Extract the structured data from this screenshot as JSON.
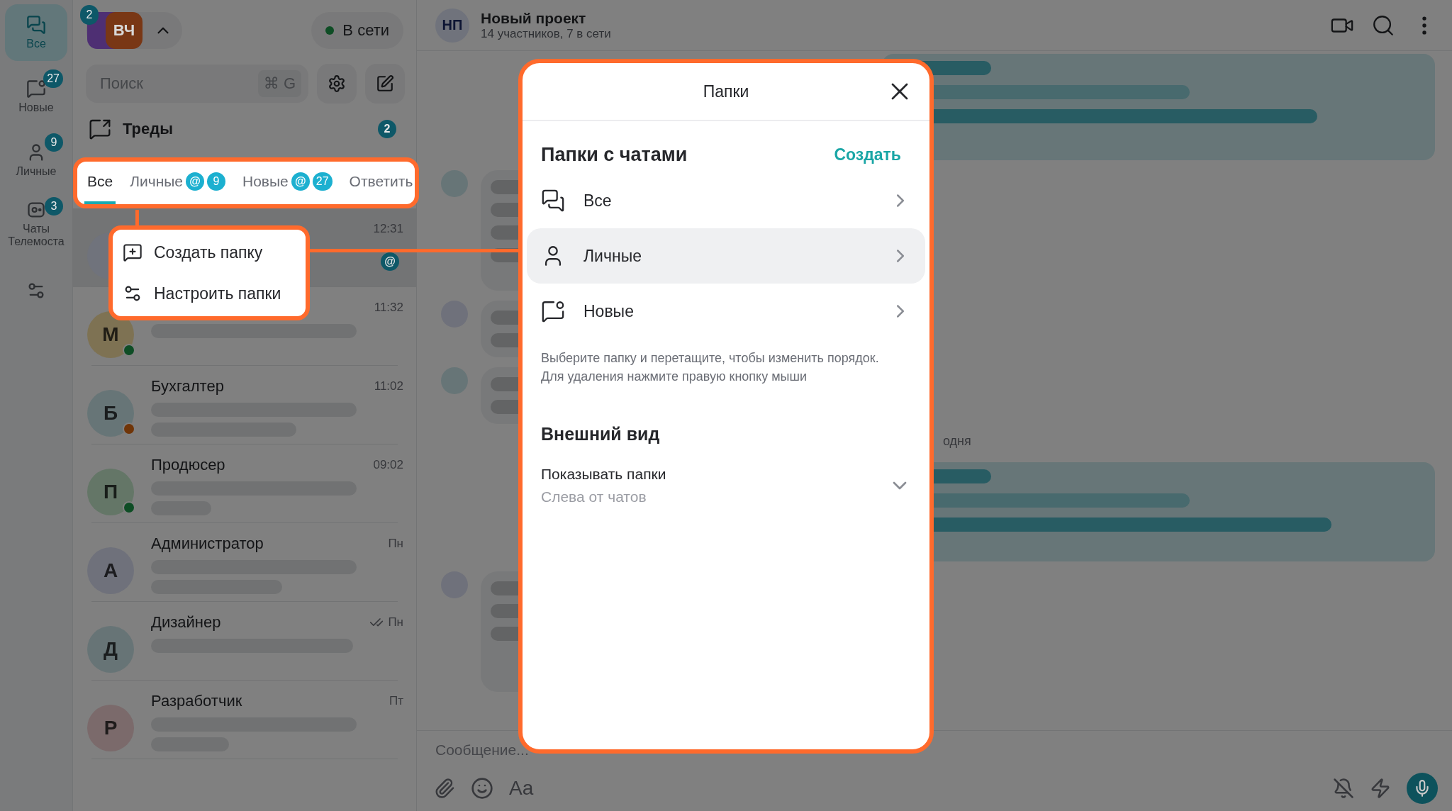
{
  "rail": {
    "items": [
      {
        "label": "Все",
        "kind": "all",
        "selected": true
      },
      {
        "label": "Новые",
        "kind": "new",
        "selected": false,
        "badge": "27"
      },
      {
        "label": "Личные",
        "kind": "personal",
        "selected": false,
        "badge": "9"
      },
      {
        "label": "Чаты Телемоста",
        "kind": "telemost",
        "selected": false,
        "badge": "3"
      }
    ]
  },
  "accounts": {
    "badge": "2",
    "avatars": [
      {
        "color": "#4e2f73"
      },
      {
        "initials": "ВЧ",
        "color": "#793715"
      }
    ]
  },
  "status": {
    "label": "В сети",
    "online": true
  },
  "search": {
    "placeholder": "Поиск",
    "shortcut": "⌘ G"
  },
  "threads": {
    "label": "Треды",
    "count": "2"
  },
  "tabs": [
    {
      "label": "Все",
      "selected": true
    },
    {
      "label": "Личные",
      "selected": false,
      "mention": "@",
      "count": "9"
    },
    {
      "label": "Новые",
      "selected": false,
      "mention": "@",
      "count": "27"
    },
    {
      "label": "Ответить",
      "selected": false
    }
  ],
  "chats": [
    {
      "time": "12:31",
      "selected": true,
      "read": false,
      "mention": "@",
      "color": "#70737c"
    },
    {
      "initials": "М",
      "time": "11:32",
      "selected": false,
      "read": false,
      "presence": {
        "color": "#0e4d25"
      },
      "color": "#7e7253"
    },
    {
      "initials": "Б",
      "name": "Бухгалтер",
      "time": "11:02",
      "selected": false,
      "read": false,
      "presence": {
        "color": "#703508"
      },
      "color": "#677577"
    },
    {
      "initials": "П",
      "name": "Продюсер",
      "time": "09:02",
      "selected": false,
      "read": false,
      "presence": {
        "color": "#0e4d25"
      },
      "color": "#647667"
    },
    {
      "initials": "А",
      "name": "Администратор",
      "time": "Пн",
      "selected": false,
      "read": false,
      "color": "#6f717b"
    },
    {
      "initials": "Д",
      "name": "Дизайнер",
      "time": "Пн",
      "selected": false,
      "read": true,
      "color": "#677476"
    },
    {
      "initials": "Р",
      "name": "Разработчик",
      "time": "Пт",
      "selected": false,
      "read": false,
      "color": "#7b6a6b"
    }
  ],
  "chat_header": {
    "initials": "НП",
    "title": "Новый проект",
    "subtitle": "14 участников, 7 в сети"
  },
  "date_label": "одня",
  "composer": {
    "placeholder": "Сообщение...",
    "format_label": "Aa"
  },
  "menu": {
    "items": [
      {
        "label": "Создать папку",
        "kind": "create"
      },
      {
        "label": "Настроить папки",
        "kind": "settings"
      }
    ]
  },
  "dialog": {
    "title": "Папки",
    "section": "Папки с чатами",
    "create_link": "Создать",
    "folders": [
      {
        "label": "Все",
        "kind": "all",
        "selected": false
      },
      {
        "label": "Личные",
        "kind": "personal",
        "selected": true
      },
      {
        "label": "Новые",
        "kind": "new",
        "selected": false
      }
    ],
    "hint": "Выберите папку и перетащите, чтобы изменить порядок.\nДля удаления нажмите правую кнопку мыши",
    "appearance": {
      "title": "Внешний вид",
      "label": "Показывать папки",
      "value": "Слева от чатов"
    }
  }
}
